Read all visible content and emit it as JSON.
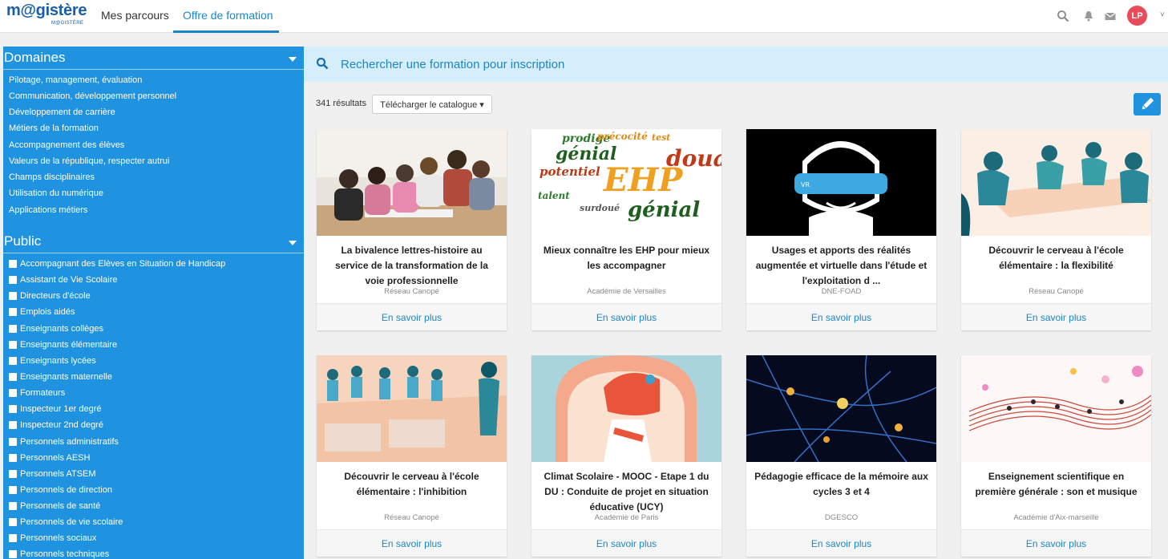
{
  "header": {
    "logo": "m@gistère",
    "logo_sub": "M@GISTÈRE",
    "nav": [
      "Mes parcours",
      "Offre de formation"
    ],
    "avatar_initials": "LP",
    "icons": [
      "search-icon",
      "bell-icon",
      "mail-icon",
      "chevron-down-icon"
    ]
  },
  "sidebar": {
    "domains_title": "Domaines",
    "domains": [
      "Pilotage, management, évaluation",
      "Communication, développement personnel",
      "Développement de carrière",
      "Métiers de la formation",
      "Accompagnement des élèves",
      "Valeurs de la république, respecter autrui",
      "Champs disciplinaires",
      "Utilisation du numérique",
      "Applications métiers"
    ],
    "public_title": "Public",
    "public": [
      "Accompagnant des Elèves en Situation de Handicap",
      "Assistant de Vie Scolaire",
      "Directeurs d'école",
      "Emplois aidés",
      "Enseignants collèges",
      "Enseignants élémentaire",
      "Enseignants lycées",
      "Enseignants maternelle",
      "Formateurs",
      "Inspecteur 1er degré",
      "Inspecteur 2nd degré",
      "Personnels administratifs",
      "Personnels AESH",
      "Personnels ATSEM",
      "Personnels de direction",
      "Personnels de santé",
      "Personnels de vie scolaire",
      "Personnels sociaux",
      "Personnels techniques"
    ]
  },
  "search": {
    "placeholder": "Rechercher une formation pour inscription",
    "results": "341 résultats",
    "catalog_button": "Télécharger le catalogue ▾"
  },
  "cards": [
    {
      "title": "La bivalence lettres-histoire au service de la transformation de la voie professionnelle",
      "source": "Réseau Canopé",
      "link": "En savoir plus"
    },
    {
      "title": "Mieux connaître les EHP pour mieux les accompagner",
      "source": "Académie de Versailles",
      "link": "En savoir plus"
    },
    {
      "title": "Usages et apports des réalités augmentée et virtuelle dans l'étude et l'exploitation d ...",
      "source": "DNE-FOAD",
      "link": "En savoir plus"
    },
    {
      "title": "Découvrir le cerveau à l'école élémentaire : la flexibilité",
      "source": "Réseau Canopé",
      "link": "En savoir plus"
    },
    {
      "title": "Découvrir le cerveau à l'école élémentaire : l'inhibition",
      "source": "Réseau Canopé",
      "link": "En savoir plus"
    },
    {
      "title": "Climat Scolaire - MOOC - Etape 1 du DU : Conduite de projet en situation éducative (UCY)",
      "source": "Académie de Paris",
      "link": "En savoir plus"
    },
    {
      "title": "Pédagogie efficace de la mémoire aux cycles 3 et 4",
      "source": "DGESCO",
      "link": "En savoir plus"
    },
    {
      "title": "Enseignement scientifique en première générale : son et musique",
      "source": "Académie d'Aix-marseille",
      "link": "En savoir plus"
    }
  ],
  "card2_words": [
    "prodige",
    "génial",
    "potentiel",
    "EHP",
    "douance",
    "précocité",
    "talent",
    "surdoué",
    "génial",
    "test"
  ],
  "card3_vr_label": "VR",
  "colors": {
    "accent": "#1f92e0",
    "link": "#1a86c8",
    "avatar": "#e84b5a",
    "searchbar": "#d6eefb"
  }
}
